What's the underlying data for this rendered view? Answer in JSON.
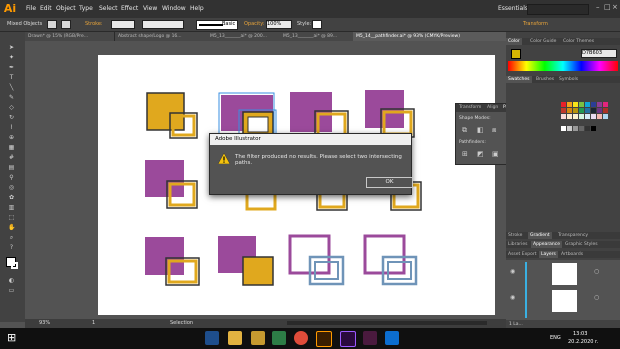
{
  "app": {
    "logo": "Ai"
  },
  "menu": [
    "File",
    "Edit",
    "Object",
    "Type",
    "Select",
    "Effect",
    "View",
    "Window",
    "Help"
  ],
  "workspace": "Essentials",
  "control_bar": {
    "selection_label": "Mixed Objects",
    "stroke_label": "Stroke:",
    "brush_label": "Basic",
    "opacity_label": "Opacity:",
    "opacity_value": "100%",
    "style_label": "Style:",
    "transform_label": "Transform"
  },
  "doc_tabs": [
    "Drawn* @ 15% (RGB/Pre...",
    "Abstract shape/Logo @ 16...",
    "M5_13_______ai* @ 200...",
    "M5_13_______ai* @ 89...",
    "M5_14__pathfinder.ai* @ 93% (CMYK/Preview)"
  ],
  "status_bar": {
    "zoom": "93%",
    "page": "1",
    "mode": "Selection"
  },
  "right_panel": {
    "color_tabs": [
      "Color",
      "Color Guide",
      "Color Themes"
    ],
    "hex": "D7B603",
    "swatch_tabs": [
      "Swatches",
      "Brushes",
      "Symbols"
    ],
    "bottom_tabs_1": [
      "Stroke",
      "Gradient",
      "Transparency"
    ],
    "bottom_tabs_2": [
      "Libraries",
      "Appearance",
      "Graphic Styles"
    ],
    "bottom_tabs_3": [
      "Asset Export",
      "Layers",
      "Artboards"
    ],
    "layers_count": "1 La..."
  },
  "pathfinder": {
    "tabs": [
      "Transform",
      "Align",
      "Pathfinder"
    ],
    "shape_modes_label": "Shape Modes:",
    "expand_label": "Expand",
    "pathfinders_label": "Pathfinders:"
  },
  "dialog": {
    "title": "Adobe Illustrator",
    "message": "The filter produced no results. Please select two intersecting paths.",
    "ok_label": "OK"
  },
  "taskbar": {
    "lang": "ENG",
    "time": "13:03",
    "date": "20.2.2020 r."
  },
  "colors": {
    "purple": "#9b4a9b",
    "gold": "#e0a81e",
    "blue": "#6f94b8",
    "accent": "#ff9a00"
  }
}
